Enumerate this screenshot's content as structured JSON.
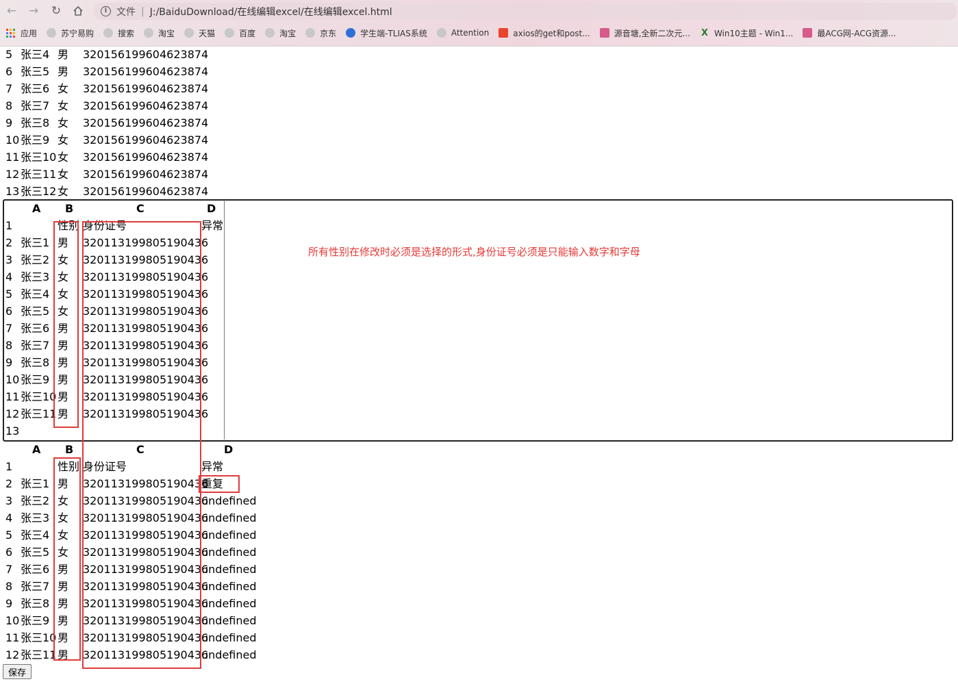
{
  "browser": {
    "address": {
      "protocol_label": "文件",
      "url": "J:/BaiduDownload/在线编辑excel/在线编辑excel.html"
    },
    "bookmarks": [
      {
        "label": "应用",
        "icon": "apps-grid-icon"
      },
      {
        "label": "苏宁易购",
        "icon": "globe-icon"
      },
      {
        "label": "搜索",
        "icon": "globe-icon"
      },
      {
        "label": "淘宝",
        "icon": "globe-icon"
      },
      {
        "label": "天猫",
        "icon": "globe-icon"
      },
      {
        "label": "百度",
        "icon": "globe-icon"
      },
      {
        "label": "淘宝",
        "icon": "globe-icon"
      },
      {
        "label": "京东",
        "icon": "globe-icon"
      },
      {
        "label": "学生端-TLIAS系统",
        "icon": "app-logo-icon"
      },
      {
        "label": "Attention",
        "icon": "globe-icon"
      },
      {
        "label": "axios的get和post...",
        "icon": "csdn-icon"
      },
      {
        "label": "源音塘,全新二次元...",
        "icon": "site-icon"
      },
      {
        "label": "Win10主题 - Win1...",
        "icon": "x-logo-icon"
      },
      {
        "label": "最ACG网-ACG资源...",
        "icon": "site-icon"
      }
    ]
  },
  "top_list": [
    {
      "n": "5",
      "name": "张三4",
      "sex": "男",
      "id": "320156199604623874"
    },
    {
      "n": "6",
      "name": "张三5",
      "sex": "男",
      "id": "320156199604623874"
    },
    {
      "n": "7",
      "name": "张三6",
      "sex": "女",
      "id": "320156199604623874"
    },
    {
      "n": "8",
      "name": "张三7",
      "sex": "女",
      "id": "320156199604623874"
    },
    {
      "n": "9",
      "name": "张三8",
      "sex": "女",
      "id": "320156199604623874"
    },
    {
      "n": "10",
      "name": "张三9",
      "sex": "女",
      "id": "320156199604623874"
    },
    {
      "n": "11",
      "name": "张三10",
      "sex": "女",
      "id": "320156199604623874"
    },
    {
      "n": "12",
      "name": "张三11",
      "sex": "女",
      "id": "320156199604623874"
    },
    {
      "n": "13",
      "name": "张三12",
      "sex": "女",
      "id": "320156199604623874"
    }
  ],
  "editable_table": {
    "headers": [
      "A",
      "B",
      "C",
      "D"
    ],
    "header_row": {
      "n": "1",
      "a": "",
      "b": "性别",
      "c": "身份证号",
      "d": "异常"
    },
    "rows": [
      {
        "n": "2",
        "a": "张三1",
        "b": "男",
        "c": "320113199805190436"
      },
      {
        "n": "3",
        "a": "张三2",
        "b": "女",
        "c": "320113199805190436"
      },
      {
        "n": "4",
        "a": "张三3",
        "b": "女",
        "c": "320113199805190436"
      },
      {
        "n": "5",
        "a": "张三4",
        "b": "女",
        "c": "320113199805190436"
      },
      {
        "n": "6",
        "a": "张三5",
        "b": "女",
        "c": "320113199805190436"
      },
      {
        "n": "7",
        "a": "张三6",
        "b": "男",
        "c": "320113199805190436"
      },
      {
        "n": "8",
        "a": "张三7",
        "b": "男",
        "c": "320113199805190436"
      },
      {
        "n": "9",
        "a": "张三8",
        "b": "男",
        "c": "320113199805190436"
      },
      {
        "n": "10",
        "a": "张三9",
        "b": "男",
        "c": "320113199805190436"
      },
      {
        "n": "11",
        "a": "张三10",
        "b": "男",
        "c": "320113199805190436"
      },
      {
        "n": "12",
        "a": "张三11",
        "b": "男",
        "c": "320113199805190436"
      }
    ],
    "last_row": "13",
    "note": "所有性别在修改时必须是选择的形式,身份证号必须是只能输入数字和字母"
  },
  "result_table": {
    "headers": [
      "A",
      "B",
      "C",
      "D"
    ],
    "header_row": {
      "n": "1",
      "a": "",
      "b": "性别",
      "c": "身份证号",
      "d": "异常"
    },
    "rows": [
      {
        "n": "2",
        "a": "张三1",
        "b": "男",
        "c": "320113199805190436",
        "d": "重复"
      },
      {
        "n": "3",
        "a": "张三2",
        "b": "女",
        "c": "320113199805190436",
        "d": "undefined"
      },
      {
        "n": "4",
        "a": "张三3",
        "b": "女",
        "c": "320113199805190436",
        "d": "undefined"
      },
      {
        "n": "5",
        "a": "张三4",
        "b": "女",
        "c": "320113199805190436",
        "d": "undefined"
      },
      {
        "n": "6",
        "a": "张三5",
        "b": "女",
        "c": "320113199805190436",
        "d": "undefined"
      },
      {
        "n": "7",
        "a": "张三6",
        "b": "男",
        "c": "320113199805190436",
        "d": "undefined"
      },
      {
        "n": "8",
        "a": "张三7",
        "b": "男",
        "c": "320113199805190436",
        "d": "undefined"
      },
      {
        "n": "9",
        "a": "张三8",
        "b": "男",
        "c": "320113199805190436",
        "d": "undefined"
      },
      {
        "n": "10",
        "a": "张三9",
        "b": "男",
        "c": "320113199805190436",
        "d": "undefined"
      },
      {
        "n": "11",
        "a": "张三10",
        "b": "男",
        "c": "320113199805190436",
        "d": "undefined"
      },
      {
        "n": "12",
        "a": "张三11",
        "b": "男",
        "c": "320113199805190436",
        "d": "undefined"
      }
    ]
  },
  "save_label": "保存",
  "colors": {
    "annotation_red": "#e03a3a",
    "note_red": "#e53935"
  }
}
